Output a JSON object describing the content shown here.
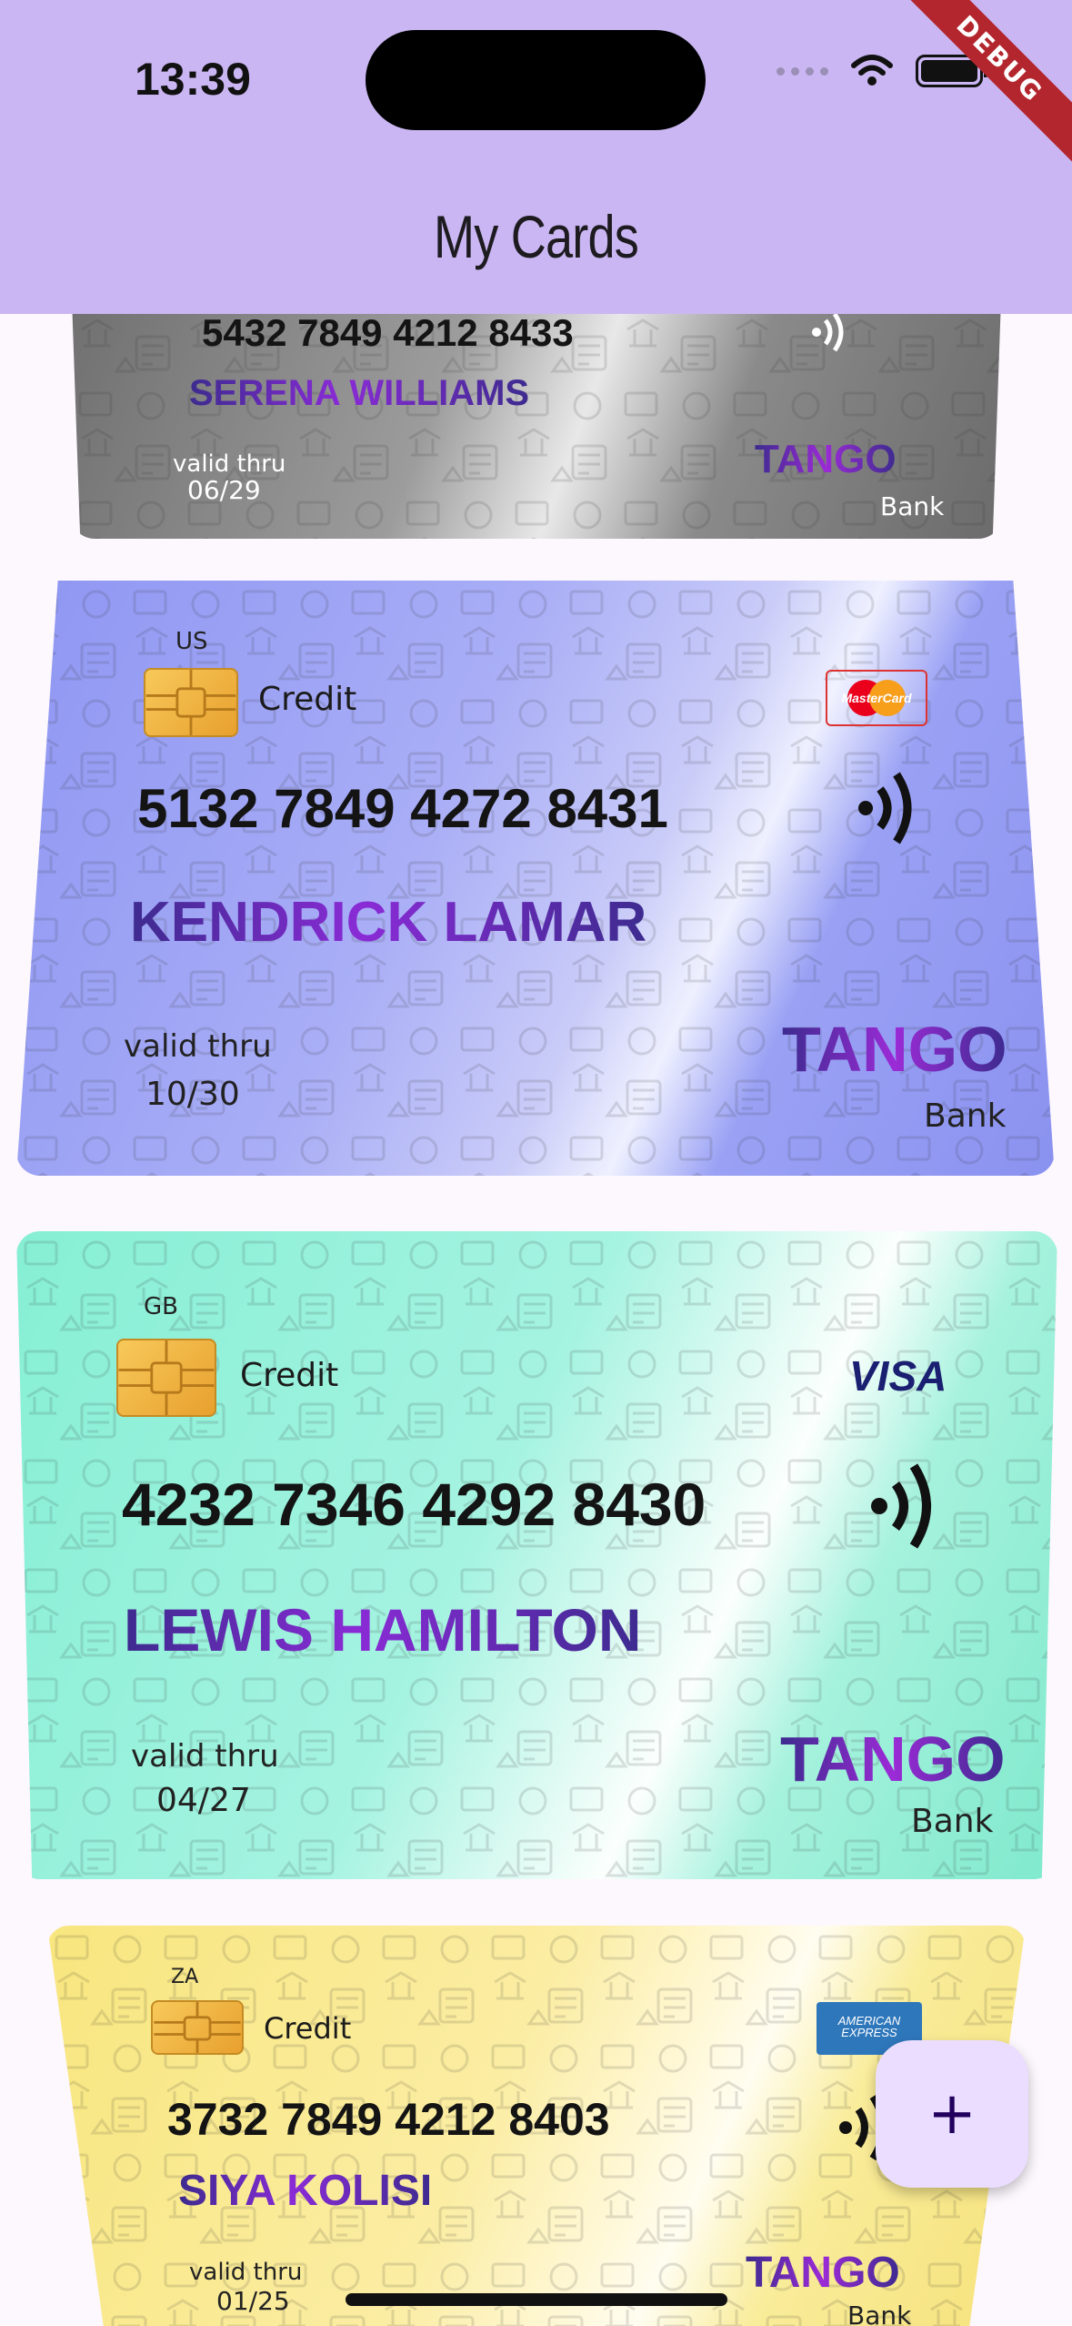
{
  "status_bar": {
    "time": "13:39",
    "debug_label": "DEBUG"
  },
  "app_bar": {
    "title": "My Cards"
  },
  "cards": [
    {
      "country": "",
      "type": "",
      "number": "5432 7849 4212 8433",
      "holder": "SERENA WILLIAMS",
      "valid_label": "valid thru",
      "expiry": "06/29",
      "brand": "TANGO",
      "bank": "Bank",
      "network": ""
    },
    {
      "country": "US",
      "type": "Credit",
      "number": "5132 7849 4272 8431",
      "holder": "KENDRICK LAMAR",
      "valid_label": "valid thru",
      "expiry": "10/30",
      "brand": "TANGO",
      "bank": "Bank",
      "network": "MasterCard"
    },
    {
      "country": "GB",
      "type": "Credit",
      "number": "4232 7346 4292 8430",
      "holder": "LEWIS HAMILTON",
      "valid_label": "valid thru",
      "expiry": "04/27",
      "brand": "TANGO",
      "bank": "Bank",
      "network": "VISA"
    },
    {
      "country": "ZA",
      "type": "Credit",
      "number": "3732 7849 4212 8403",
      "holder": "SIYA KOLISI",
      "valid_label": "valid thru",
      "expiry": "01/25",
      "brand": "TANGO",
      "bank": "Bank",
      "network": "AMERICAN EXPRESS"
    }
  ],
  "fab": {
    "label": "+"
  },
  "colors": {
    "app_bar": "#CAB6F2",
    "background": "#FDF7FE",
    "card_silver": "#9a9a9a",
    "card_blue": "#9fa6f5",
    "card_mint": "#8ff0d8",
    "card_yellow": "#f9e98f",
    "fab": "#EADDFF"
  }
}
